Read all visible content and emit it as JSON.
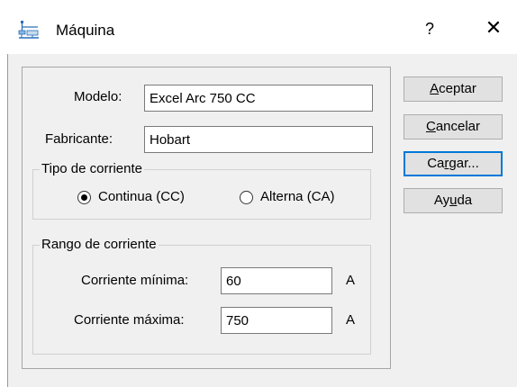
{
  "window": {
    "title": "Máquina",
    "help_label": "?",
    "close_label": "✕"
  },
  "form": {
    "model_label": "Modelo:",
    "model_value": "Excel Arc 750 CC",
    "manufacturer_label": "Fabricante:",
    "manufacturer_value": "Hobart"
  },
  "current_type": {
    "title": "Tipo de corriente",
    "options": [
      {
        "label": "Continua (CC)",
        "checked": true
      },
      {
        "label": "Alterna (CA)",
        "checked": false
      }
    ]
  },
  "current_range": {
    "title": "Rango de corriente",
    "min_label": "Corriente mínima:",
    "min_value": "60",
    "max_label": "Corriente máxima:",
    "max_value": "750",
    "unit": "A"
  },
  "buttons": {
    "accept": {
      "pre": "",
      "key": "A",
      "post": "ceptar"
    },
    "cancel": {
      "pre": "",
      "key": "C",
      "post": "ancelar"
    },
    "load": {
      "pre": "Ca",
      "key": "r",
      "post": "gar..."
    },
    "help": {
      "pre": "Ay",
      "key": "u",
      "post": "da"
    }
  },
  "colors": {
    "focus_border": "#0078d7",
    "dialog_bg": "#f0f0f0",
    "button_bg": "#e1e1e1"
  }
}
